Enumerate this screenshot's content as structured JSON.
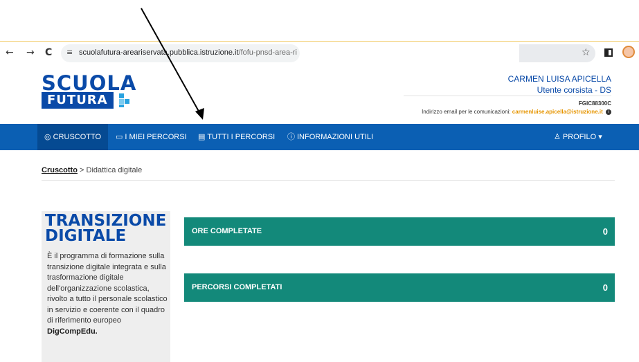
{
  "browser": {
    "back": "←",
    "forward": "→",
    "reload": "C",
    "site_icon": "≡",
    "url_host": "scuolafutura-areariservata.pubblica.istruzione.it",
    "url_path": "/fofu-pnsd-area-riservata-w",
    "star": "☆"
  },
  "logo": {
    "line1": "SCUOLA",
    "line2": "FUTURA"
  },
  "user": {
    "name": "CARMEN LUISA APICELLA",
    "role": "Utente corsista - DS",
    "code": "FGIC88300C",
    "email_label": "Indirizzo email per le comunicazioni:",
    "email": "carmenluise.apicella@istruzione.it",
    "info_icon": "i"
  },
  "nav": {
    "items": [
      {
        "icon": "◎",
        "label": "CRUSCOTTO"
      },
      {
        "icon": "▭",
        "label": "I MIEI PERCORSI"
      },
      {
        "icon": "▤",
        "label": "TUTTI I PERCORSI"
      },
      {
        "icon": "ⓘ",
        "label": "INFORMAZIONI UTILI"
      },
      {
        "icon": "♙",
        "label": "PROFILO ▾"
      }
    ]
  },
  "breadcrumb": {
    "link": "Cruscotto",
    "sep": ">",
    "current": "Didattica digitale"
  },
  "panel": {
    "title1": "TRANSIZIONE",
    "title2": "DIGITALE",
    "description": "È il programma di formazione sulla transizione digitale integrata e sulla trasformazione digitale dell'organizzazione scolastica, rivolto a tutto il personale scolastico in servizio e coerente con il quadro di riferimento europeo",
    "highlight": "DigCompEdu."
  },
  "stats": [
    {
      "label": "ORE COMPLETATE",
      "value": "0"
    },
    {
      "label": "PERCORSI COMPLETATI",
      "value": "0"
    }
  ],
  "colors": {
    "primary": "#0b5fb3",
    "teal": "#13897a",
    "accent": "#e69500"
  }
}
